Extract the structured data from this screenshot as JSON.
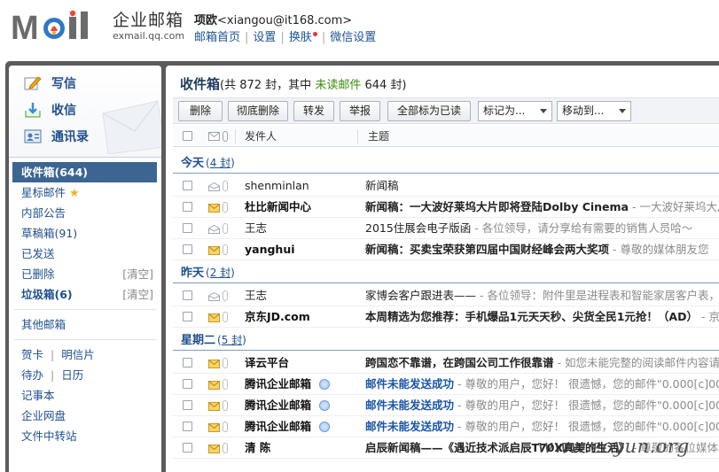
{
  "header": {
    "brand_cn": "企业邮箱",
    "brand_en": "exmail.qq.com",
    "user_name": "项欧",
    "user_email": "<xiangou@it168.com>",
    "links": [
      "邮箱首页",
      "设置",
      "换肤",
      "微信设置"
    ]
  },
  "sidebar": {
    "compose": "写信",
    "receive": "收信",
    "contacts": "通讯录",
    "folders": [
      {
        "label": "收件箱(644)"
      },
      {
        "label": "星标邮件"
      },
      {
        "label": "内部公告"
      },
      {
        "label": "草稿箱(91)"
      },
      {
        "label": "已发送"
      },
      {
        "label": "已删除",
        "action": "[清空]"
      },
      {
        "label": "垃圾箱(6)",
        "action": "[清空]"
      }
    ],
    "other_mailbox": "其他邮箱",
    "tools": [
      [
        "贺卡",
        "明信片"
      ],
      [
        "待办",
        "日历"
      ]
    ],
    "notepad": "记事本",
    "netdisk": "企业网盘",
    "transfer": "文件中转站"
  },
  "main": {
    "folder_title": "收件箱",
    "count_pre": "(共 872 封，其中 ",
    "unread_label": "未读邮件",
    "count_post": " 644 封)",
    "toolbar": {
      "delete": "删除",
      "delete_perm": "彻底删除",
      "forward": "转发",
      "report": "举报",
      "mark_all_read": "全部标为已读",
      "mark_as": "标记为...",
      "move_to": "移动到..."
    },
    "columns": {
      "sender": "发件人",
      "subject": "主题"
    },
    "groups": [
      {
        "label": "今天",
        "count_pre": "(",
        "count": "4 封",
        "count_post": ")",
        "rows": [
          {
            "sender": "shenminlan",
            "subject": "新闻稿",
            "preview": "",
            "unread": false
          },
          {
            "sender": "杜比新闻中心",
            "subject": "新闻稿：一大波好莱坞大片即将登陆Dolby Cinema",
            "preview": " - 一大波好莱坞大片",
            "unread": true
          },
          {
            "sender": "王志",
            "subject": "2015住展会电子版函",
            "preview": " - 各位领导，请分享给有需要的销售人员哈～",
            "unread": false
          },
          {
            "sender": "yanghui",
            "subject": "新闻稿：买卖宝荣获第四届中国财经峰会两大奖项",
            "preview": " - 尊敬的媒体朋友您",
            "unread": true
          }
        ]
      },
      {
        "label": "昨天",
        "count_pre": "(",
        "count": "2 封",
        "count_post": ")",
        "rows": [
          {
            "sender": "王志",
            "subject": "家博会客户跟进表——",
            "preview": " - 各位领导：附件里是进程表和智能家居客户表，已",
            "unread": false
          },
          {
            "sender": "京东JD.com",
            "subject": "本周精选为您推荐：手机爆品1元天天秒、尖货全民1元抢！（AD）",
            "preview": " - 京东",
            "unread": true
          }
        ]
      },
      {
        "label": "星期二",
        "count_pre": "(",
        "count": "5 封",
        "count_post": ")",
        "rows": [
          {
            "sender": "译云平台",
            "subject": "跨国恋不靠谱，在跨国公司工作很靠谱",
            "preview": " - 如您未能完整的阅读邮件内容请",
            "unread": true
          },
          {
            "sender": "腾讯企业邮箱",
            "subject": "邮件未能发送成功",
            "preview": " - 尊敬的用户，您好！ 很遗憾，您的邮件\"0.000[c]00",
            "unread": true,
            "qq": true,
            "blue": true
          },
          {
            "sender": "腾讯企业邮箱",
            "subject": "邮件未能发送成功",
            "preview": " - 尊敬的用户，您好！ 很遗憾，您的邮件\"0.000[c]00",
            "unread": true,
            "qq": true,
            "blue": true
          },
          {
            "sender": "腾讯企业邮箱",
            "subject": "邮件未能发送成功",
            "preview": " - 尊敬的用户，您好！ 很遗憾，您的邮件\"0.000[c]00",
            "unread": true,
            "qq": true,
            "blue": true
          },
          {
            "sender": "清 陈",
            "subject": "启辰新闻稿——《遇近技术派启辰T70X真美的生活》",
            "preview": " - 尊敬的各位媒体",
            "unread": true
          }
        ]
      }
    ]
  },
  "watermark": "www.eoyun.org",
  "colors": {
    "accent": "#3c6592",
    "link": "#1e4f8e",
    "unread_green": "#3a8b12",
    "frame": "#5b5b5b"
  }
}
